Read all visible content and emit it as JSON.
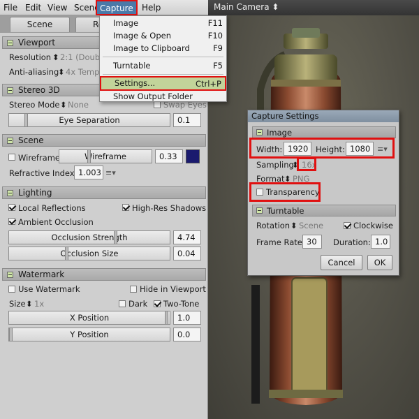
{
  "menubar": {
    "items": [
      "File",
      "Edit",
      "View",
      "Scene",
      "Capture",
      "Help"
    ]
  },
  "viewport": {
    "camera_label": "Main Camera"
  },
  "tabs": [
    "Scene",
    "Re"
  ],
  "viewport_section": {
    "title": "Viewport",
    "resolution_label": "Resolution",
    "resolution_value": "2:1 (Double",
    "antialiasing_label": "Anti-aliasing",
    "antialiasing_value": "4x Temp"
  },
  "stereo_section": {
    "title": "Stereo 3D",
    "mode_label": "Stereo Mode",
    "mode_value": "None",
    "swap_label": "Swap Eyes",
    "separation_label": "Eye Separation",
    "separation_value": "0.1"
  },
  "scene_section": {
    "title": "Scene",
    "wireframe_label": "Wireframe",
    "wireframe_slider_label": "Wireframe",
    "wireframe_value": "0.33",
    "wireframe_color": "#1a1a6e",
    "refractive_label": "Refractive Index:",
    "refractive_value": "1.003"
  },
  "lighting_section": {
    "title": "Lighting",
    "local_reflections": "Local Reflections",
    "local_reflections_checked": true,
    "highres_shadows": "High-Res Shadows",
    "highres_shadows_checked": true,
    "ambient_occlusion": "Ambient Occlusion",
    "ambient_occlusion_checked": true,
    "occlusion_strength_label": "Occlusion Strength",
    "occlusion_strength_value": "4.74",
    "occlusion_size_label": "Occlusion Size",
    "occlusion_size_value": "0.04"
  },
  "watermark_section": {
    "title": "Watermark",
    "use_watermark": "Use Watermark",
    "hide_in_viewport": "Hide in Viewport",
    "size_label": "Size",
    "size_value": "1x",
    "dark_label": "Dark",
    "two_tone_label": "Two-Tone",
    "two_tone_checked": true,
    "x_position_label": "X Position",
    "x_position_value": "1.0",
    "y_position_label": "Y Position",
    "y_position_value": "0.0"
  },
  "capture_menu": {
    "items": [
      {
        "label": "Image",
        "shortcut": "F11"
      },
      {
        "label": "Image & Open",
        "shortcut": "F10"
      },
      {
        "label": "Image to Clipboard",
        "shortcut": "F9"
      },
      {
        "label": "Turntable",
        "shortcut": "F5"
      },
      {
        "label": "Settings...",
        "shortcut": "Ctrl+P"
      },
      {
        "label": "Show Output Folder",
        "shortcut": ""
      }
    ]
  },
  "dialog": {
    "title": "Capture Settings",
    "image_section": "Image",
    "width_label": "Width:",
    "width_value": "1920",
    "height_label": "Height:",
    "height_value": "1080",
    "sampling_label": "Sampling",
    "sampling_value": "16x",
    "format_label": "Format",
    "format_value": "PNG",
    "transparency_label": "Transparency",
    "turntable_section": "Turntable",
    "rotation_label": "Rotation",
    "rotation_value": "Scene",
    "clockwise_label": "Clockwise",
    "frame_rate_label": "Frame Rate:",
    "frame_rate_value": "30",
    "duration_label": "Duration:",
    "duration_value": "1.0",
    "cancel_label": "Cancel",
    "ok_label": "OK"
  },
  "colors": {
    "highlight_box": "#e01010",
    "menu_active": "#4b79a8",
    "menu_highlight": "#c2d49a"
  }
}
